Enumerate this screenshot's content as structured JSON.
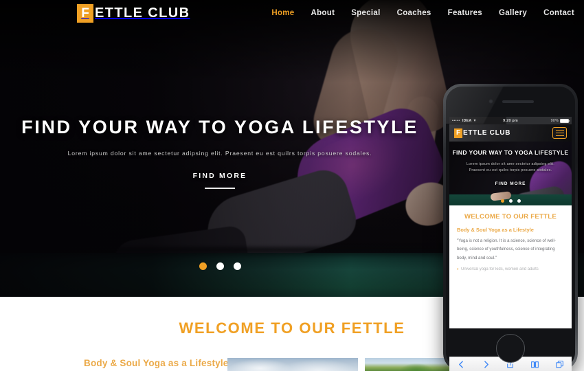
{
  "brand": {
    "badge_letter": "F",
    "name": "ETTLE CLUB",
    "accent": "#f0a024"
  },
  "nav": {
    "items": [
      {
        "label": "Home",
        "active": true
      },
      {
        "label": "About",
        "active": false
      },
      {
        "label": "Special",
        "active": false
      },
      {
        "label": "Coaches",
        "active": false
      },
      {
        "label": "Features",
        "active": false
      },
      {
        "label": "Gallery",
        "active": false
      },
      {
        "label": "Contact",
        "active": false
      }
    ]
  },
  "hero": {
    "title": "FIND YOUR WAY TO YOGA LIFESTYLE",
    "subtitle": "Lorem ipsum dolor sit ame sectetur adipsing elit. Praesent eu est quilrs torpis posuere sodales.",
    "button": "FIND MORE",
    "slides": [
      {
        "active": true
      },
      {
        "active": false
      },
      {
        "active": false
      }
    ]
  },
  "welcome": {
    "heading": "WELCOME TO OUR FETTLE",
    "subheading": "Body & Soul Yoga as a Lifestyle",
    "thumb_a_alt": "sky-clouds-image",
    "thumb_b_alt": "trees-landscape-image"
  },
  "phone": {
    "status": {
      "signal": "•••••",
      "carrier": "IDEA",
      "wifi": "▾",
      "time": "9:20 pm",
      "battery_label": "90%"
    },
    "header": {
      "badge_letter": "F",
      "name": "ETTLE CLUB",
      "menu_icon": "hamburger-icon"
    },
    "hero": {
      "title": "FIND YOUR WAY TO YOGA LIFESTYLE",
      "subtitle_line1": "Lorem ipsum dolor sit ame sectetur adipsing elit.",
      "subtitle_line2": "Praesent eu est quilrs torpis posuere sodales.",
      "button": "FIND MORE",
      "slides": [
        {
          "active": true
        },
        {
          "active": false
        },
        {
          "active": false
        }
      ]
    },
    "content": {
      "heading": "WELCOME TO OUR FETTLE",
      "subheading": "Body & Soul Yoga as a Lifestyle",
      "quote": "\"Yoga is not a religion. It is a science, science of well-being, science of youthfulness, science of integrating body, mind and soul.\"",
      "bullet_marker": "▸",
      "bullet_text": "Universal yoga for kids, women and adults"
    },
    "toolbar": {
      "items": [
        {
          "icon": "back-chevron-icon"
        },
        {
          "icon": "forward-chevron-icon"
        },
        {
          "icon": "share-icon"
        },
        {
          "icon": "bookmarks-icon"
        },
        {
          "icon": "tabs-icon"
        }
      ]
    }
  }
}
